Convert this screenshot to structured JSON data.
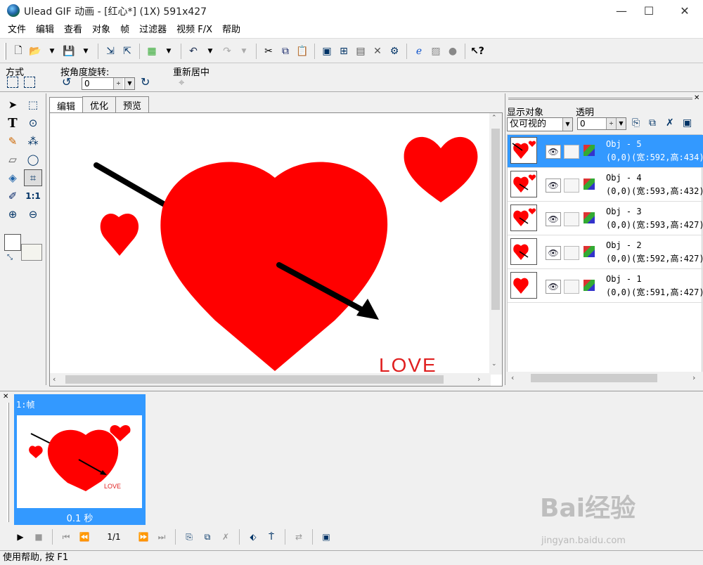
{
  "window": {
    "title": "Ulead GIF 动画 - [红心*] (1X) 591x427",
    "minimize": "—",
    "maximize": "☐",
    "close": "✕"
  },
  "menu": [
    "文件",
    "编辑",
    "查看",
    "对象",
    "帧",
    "过滤器",
    "视频 F/X",
    "帮助"
  ],
  "options": {
    "mode_label": "方式",
    "rotate_label": "按角度旋转:",
    "rotate_value": "0",
    "recenter_label": "重新居中"
  },
  "tabs": [
    "编辑",
    "优化",
    "预览"
  ],
  "canvas": {
    "love_text": "LOVE"
  },
  "right_panel": {
    "show_objects_label": "显示对象",
    "transparency_label": "透明",
    "show_objects_value": "仅可视的",
    "transparency_value": "0",
    "objects": [
      {
        "name": "Obj - 5",
        "info": "(0,0)(宽:592,高:434)",
        "selected": true
      },
      {
        "name": "Obj - 4",
        "info": "(0,0)(宽:593,高:432)",
        "selected": false
      },
      {
        "name": "Obj - 3",
        "info": "(0,0)(宽:593,高:427)",
        "selected": false
      },
      {
        "name": "Obj - 2",
        "info": "(0,0)(宽:592,高:427)",
        "selected": false
      },
      {
        "name": "Obj - 1",
        "info": "(0,0)(宽:591,高:427)",
        "selected": false
      }
    ]
  },
  "frames": [
    {
      "label": "1:帧",
      "delay": "0.1 秒",
      "love_text": "LOVE"
    }
  ],
  "player": {
    "counter": "1/1"
  },
  "status": {
    "text": "使用帮助, 按 F1"
  },
  "watermark": {
    "brand": "Bai经验",
    "url": "jingyan.baidu.com"
  },
  "colors": {
    "selection": "#3399ff",
    "heart": "#ff0000"
  }
}
